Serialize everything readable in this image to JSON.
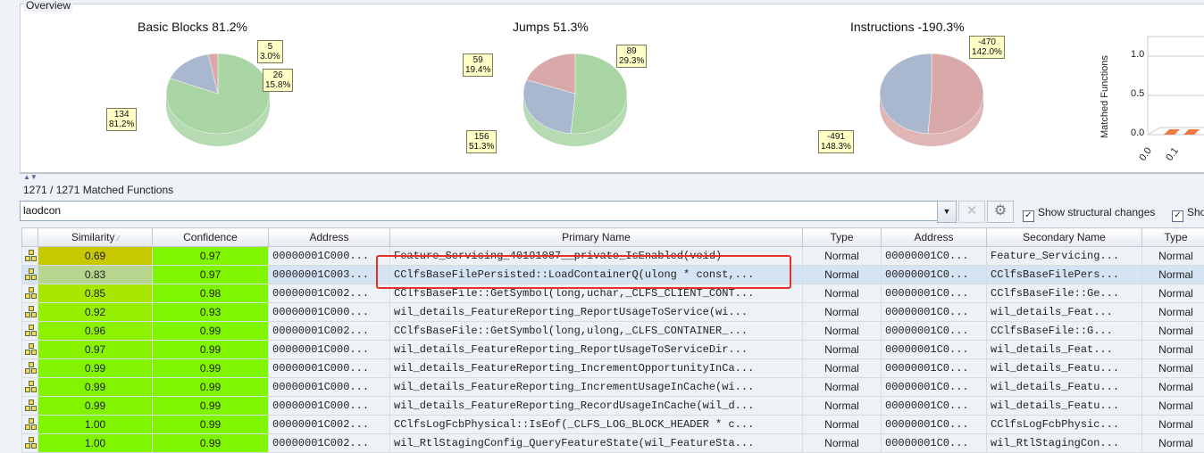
{
  "overview": {
    "title": "Overview",
    "charts": [
      {
        "title": "Basic Blocks 81.2%",
        "callouts": [
          {
            "value": "5",
            "percent": "3.0%"
          },
          {
            "value": "26",
            "percent": "15.8%"
          },
          {
            "value": "134",
            "percent": "81.2%"
          }
        ]
      },
      {
        "title": "Jumps 51.3%",
        "callouts": [
          {
            "value": "59",
            "percent": "19.4%"
          },
          {
            "value": "89",
            "percent": "29.3%"
          },
          {
            "value": "156",
            "percent": "51.3%"
          }
        ]
      },
      {
        "title": "Instructions -190.3%",
        "callouts": [
          {
            "value": "-470",
            "percent": "142.0%"
          },
          {
            "value": "-491",
            "percent": "148.3%"
          }
        ]
      }
    ],
    "bar_chart": {
      "ylabel": "Matched Functions",
      "yticks": [
        "1.0",
        "0.5",
        "0.0"
      ],
      "xticks": [
        "0.0",
        "0.1"
      ]
    }
  },
  "chart_data": [
    {
      "type": "pie",
      "title": "Basic Blocks 81.2%",
      "values": [
        134,
        26,
        5
      ],
      "labels": [
        "134 81.2%",
        "26 15.8%",
        "5 3.0%"
      ],
      "colors": [
        "#a9d5a4",
        "#aab8cf",
        "#d9a8a8"
      ]
    },
    {
      "type": "pie",
      "title": "Jumps 51.3%",
      "values": [
        156,
        89,
        59
      ],
      "labels": [
        "156 51.3%",
        "89 29.3%",
        "59 19.4%"
      ],
      "colors": [
        "#a9d5a4",
        "#aab8cf",
        "#d9a8a8"
      ]
    },
    {
      "type": "pie",
      "title": "Instructions -190.3%",
      "values": [
        491,
        470
      ],
      "labels": [
        "-491 148.3%",
        "-470 142.0%"
      ],
      "colors": [
        "#d9a8a8",
        "#aab8cf"
      ]
    }
  ],
  "matched": {
    "label": "1271 / 1271 Matched Functions"
  },
  "filter": {
    "value": "laodcon"
  },
  "options": {
    "show_structural_changes": "Show structural changes",
    "show_cut": "Sho"
  },
  "table": {
    "headers": {
      "similarity": "Similarity",
      "confidence": "Confidence",
      "address": "Address",
      "primary_name": "Primary Name",
      "type": "Type",
      "address2": "Address",
      "secondary_name": "Secondary Name",
      "type2": "Type"
    },
    "rows": [
      {
        "similarity": "0.69",
        "confidence": "0.97",
        "address": "00000001C000...",
        "primary": "Feature_Servicing_40191087__private_IsEnabled(void)",
        "type": "Normal",
        "address2": "00000001C0...",
        "secondary": "Feature_Servicing...",
        "type2": "Normal",
        "color": "#c8c800"
      },
      {
        "similarity": "0.83",
        "confidence": "0.97",
        "address": "00000001C003...",
        "primary": "CClfsBaseFilePersisted::LoadContainerQ(ulong * const,...",
        "type": "Normal",
        "address2": "00000001C0...",
        "secondary": "CClfsBaseFilePers...",
        "type2": "Normal",
        "color": "#b7d58c",
        "selected": true
      },
      {
        "similarity": "0.85",
        "confidence": "0.98",
        "address": "00000001C002...",
        "primary": "CClfsBaseFile::GetSymbol(long,uchar,_CLFS_CLIENT_CONT...",
        "type": "Normal",
        "address2": "00000001C0...",
        "secondary": "CClfsBaseFile::Ge...",
        "type2": "Normal",
        "color": "#a8e800"
      },
      {
        "similarity": "0.92",
        "confidence": "0.93",
        "address": "00000001C000...",
        "primary": "wil_details_FeatureReporting_ReportUsageToService(wi...",
        "type": "Normal",
        "address2": "00000001C0...",
        "secondary": "wil_details_Feat...",
        "type2": "Normal",
        "color": "#96f000"
      },
      {
        "similarity": "0.96",
        "confidence": "0.99",
        "address": "00000001C002...",
        "primary": "CClfsBaseFile::GetSymbol(long,ulong,_CLFS_CONTAINER_...",
        "type": "Normal",
        "address2": "00000001C0...",
        "secondary": "CClfsBaseFile::G...",
        "type2": "Normal",
        "color": "#8cf200"
      },
      {
        "similarity": "0.97",
        "confidence": "0.99",
        "address": "00000001C000...",
        "primary": "wil_details_FeatureReporting_ReportUsageToServiceDir...",
        "type": "Normal",
        "address2": "00000001C0...",
        "secondary": "wil_details_Feat...",
        "type2": "Normal",
        "color": "#88f300"
      },
      {
        "similarity": "0.99",
        "confidence": "0.99",
        "address": "00000001C000...",
        "primary": "wil_details_FeatureReporting_IncrementOpportunityInCa...",
        "type": "Normal",
        "address2": "00000001C0...",
        "secondary": "wil_details_Featu...",
        "type2": "Normal",
        "color": "#82f400"
      },
      {
        "similarity": "0.99",
        "confidence": "0.99",
        "address": "00000001C000...",
        "primary": "wil_details_FeatureReporting_IncrementUsageInCache(wi...",
        "type": "Normal",
        "address2": "00000001C0...",
        "secondary": "wil_details_Featu...",
        "type2": "Normal",
        "color": "#82f400"
      },
      {
        "similarity": "0.99",
        "confidence": "0.99",
        "address": "00000001C000...",
        "primary": "wil_details_FeatureReporting_RecordUsageInCache(wil_d...",
        "type": "Normal",
        "address2": "00000001C0...",
        "secondary": "wil_details_Featu...",
        "type2": "Normal",
        "color": "#82f400"
      },
      {
        "similarity": "1.00",
        "confidence": "0.99",
        "address": "00000001C002...",
        "primary": "CClfsLogFcbPhysical::IsEof(_CLFS_LOG_BLOCK_HEADER * c...",
        "type": "Normal",
        "address2": "00000001C0...",
        "secondary": "CClfsLogFcbPhysic...",
        "type2": "Normal",
        "color": "#80f500"
      },
      {
        "similarity": "1.00",
        "confidence": "0.99",
        "address": "00000001C002...",
        "primary": "wil_RtlStagingConfig_QueryFeatureState(wil_FeatureSta...",
        "type": "Normal",
        "address2": "00000001C0...",
        "secondary": "wil_RtlStagingCon...",
        "type2": "Normal",
        "color": "#80f500"
      }
    ]
  }
}
